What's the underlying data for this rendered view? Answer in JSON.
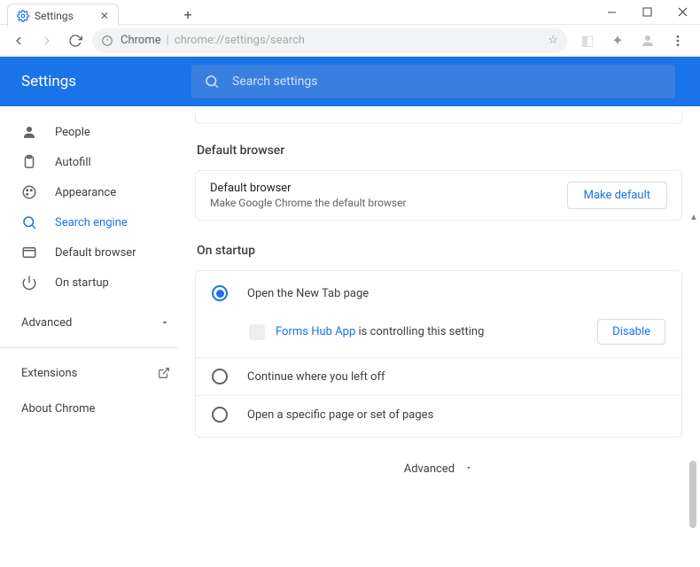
{
  "window": {
    "tab_title": "Settings",
    "newtab_tooltip": "New tab"
  },
  "toolbar": {
    "secure_chip": "Chrome",
    "url": "chrome://settings/search"
  },
  "header": {
    "title": "Settings",
    "search_placeholder": "Search settings"
  },
  "sidebar": {
    "items": [
      {
        "label": "People"
      },
      {
        "label": "Autofill"
      },
      {
        "label": "Appearance"
      },
      {
        "label": "Search engine"
      },
      {
        "label": "Default browser"
      },
      {
        "label": "On startup"
      }
    ],
    "advanced": "Advanced",
    "extensions": "Extensions",
    "about": "About Chrome"
  },
  "content": {
    "default_browser": {
      "section": "Default browser",
      "title": "Default browser",
      "subtitle": "Make Google Chrome the default browser",
      "button": "Make default"
    },
    "startup": {
      "section": "On startup",
      "options": [
        "Open the New Tab page",
        "Continue where you left off",
        "Open a specific page or set of pages"
      ],
      "control_ext": "Forms Hub App",
      "control_suffix": " is controlling this setting",
      "disable": "Disable"
    },
    "advanced_bottom": "Advanced"
  }
}
